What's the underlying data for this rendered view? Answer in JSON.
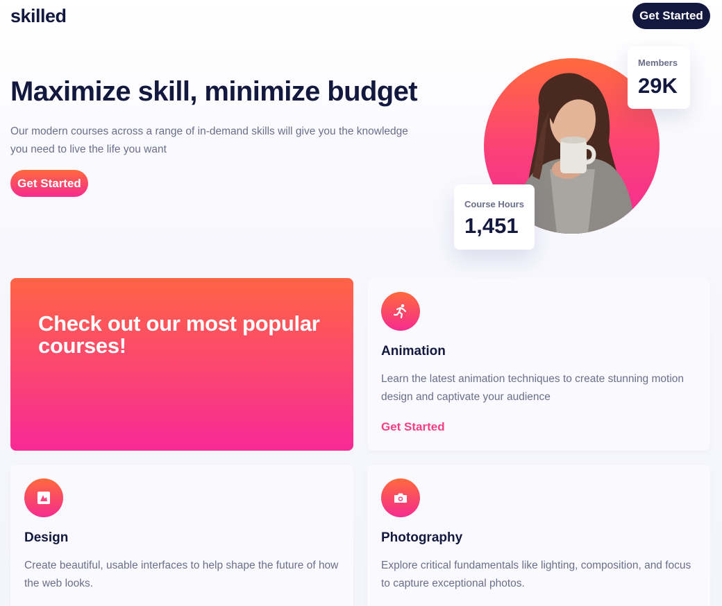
{
  "header": {
    "logo": "skilled",
    "cta_label": "Get Started"
  },
  "hero": {
    "title": "Maximize skill, minimize budget",
    "subtitle": "Our modern courses across a range of in-demand skills will give you the knowledge you need to live the life you want",
    "cta_label": "Get Started",
    "stats": {
      "members_label": "Members",
      "members_value": "29K",
      "hours_label": "Course Hours",
      "hours_value": "1,451"
    }
  },
  "courses": {
    "promo_title": "Check out our most popular courses!",
    "items": [
      {
        "icon": "running-person-icon",
        "title": "Animation",
        "description": "Learn the latest animation techniques to create stunning motion design and captivate your audience",
        "link_label": "Get Started"
      },
      {
        "icon": "design-icon",
        "title": "Design",
        "description": "Create beautiful, usable interfaces to help shape the future of how the web looks."
      },
      {
        "icon": "camera-icon",
        "title": "Photography",
        "description": "Explore critical fundamentals like lighting, composition, and focus to capture exceptional photos."
      }
    ]
  },
  "colors": {
    "navy": "#13183f",
    "gradient_start": "#ff6a3d",
    "gradient_end": "#f62b8f",
    "body_text": "#6b6e8a",
    "accent_link": "#f53f85"
  }
}
